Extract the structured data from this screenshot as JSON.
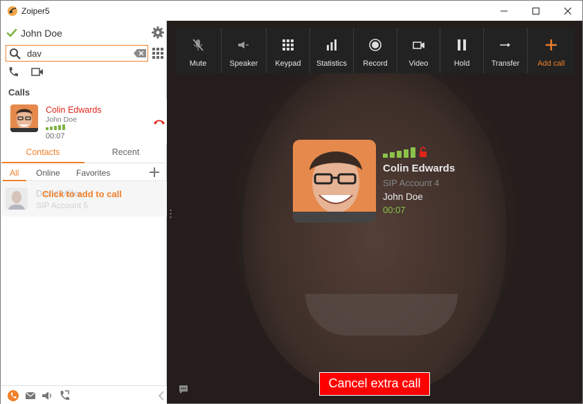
{
  "window": {
    "title": "Zoiper5"
  },
  "user": {
    "name": "John Doe"
  },
  "search": {
    "value": "dav",
    "placeholder": ""
  },
  "calls": {
    "heading": "Calls",
    "items": [
      {
        "name": "Colin Edwards",
        "account": "John Doe",
        "timer": "00:07"
      }
    ]
  },
  "tabs": {
    "contacts": "Contacts",
    "recent": "Recent"
  },
  "filters": {
    "all": "All",
    "online": "Online",
    "favorites": "Favorites"
  },
  "contact": {
    "name": "David Miller",
    "account": "SIP Account 5",
    "overlay": "Click to add to call"
  },
  "toolbar": {
    "mute": "Mute",
    "speaker": "Speaker",
    "keypad": "Keypad",
    "statistics": "Statistics",
    "record": "Record",
    "video": "Video",
    "hold": "Hold",
    "transfer": "Transfer",
    "add_call": "Add call"
  },
  "active_call": {
    "name": "Colin Edwards",
    "account": "SIP Account 4",
    "user": "John Doe",
    "timer": "00:07"
  },
  "actions": {
    "cancel_extra_call": "Cancel extra call"
  },
  "colors": {
    "accent": "#f0802a",
    "danger": "#ff0000",
    "signal": "#8bc34a",
    "toolbar_bg": "#222222"
  }
}
